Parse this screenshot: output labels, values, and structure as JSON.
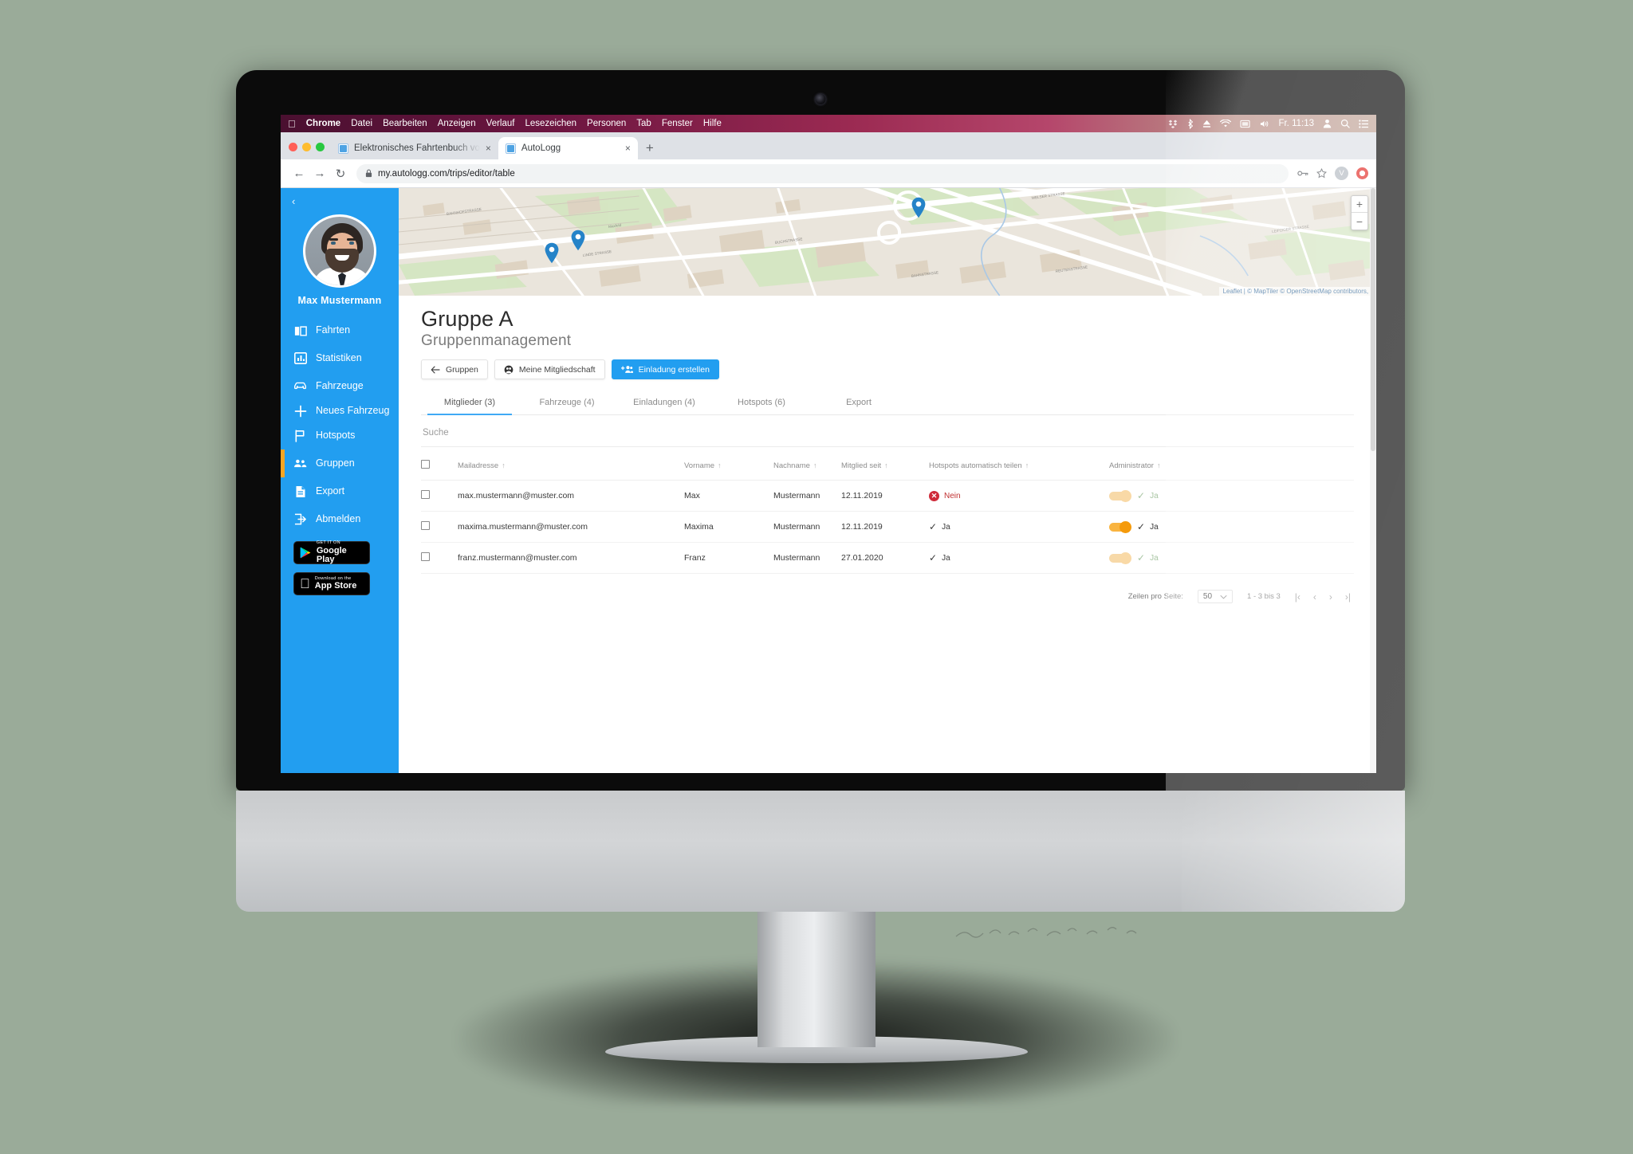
{
  "macos_menubar": {
    "apple_icon": "apple-icon",
    "items": [
      "Chrome",
      "Datei",
      "Bearbeiten",
      "Anzeigen",
      "Verlauf",
      "Lesezeichen",
      "Personen",
      "Tab",
      "Fenster",
      "Hilfe"
    ],
    "status": {
      "icons": [
        "dropbox-icon",
        "bluetooth-icon",
        "eject-icon",
        "wifi-icon",
        "screen-icon",
        "volume-icon"
      ],
      "clock": "Fr. 11:13",
      "trailing_icons": [
        "user-icon",
        "search-icon",
        "control-center-icon"
      ]
    }
  },
  "browser": {
    "tabs": [
      {
        "title": "Elektronisches Fahrtenbuch vo",
        "close": "×",
        "active": false
      },
      {
        "title": "AutoLogg",
        "close": "×",
        "active": true
      }
    ],
    "new_tab_label": "+",
    "nav": {
      "back": "←",
      "forward": "→",
      "reload": "↻"
    },
    "omnibox": {
      "lock_icon": "lock-icon",
      "url": "my.autologg.com/trips/editor/table"
    },
    "toolbar_right": {
      "key_icon": "key-icon",
      "star_icon": "star-icon",
      "profile_initial": "V",
      "extension_icon": "extension-icon"
    }
  },
  "sidebar": {
    "collapse_label": "‹",
    "user_name": "Max Mustermann",
    "items": [
      {
        "label": "Fahrten",
        "icon": "book-icon",
        "active": false
      },
      {
        "label": "Statistiken",
        "icon": "chart-icon",
        "active": false
      },
      {
        "label": "Fahrzeuge",
        "icon": "car-icon",
        "active": false
      },
      {
        "label": "Neues Fahrzeug",
        "icon": "plus-icon",
        "active": false
      },
      {
        "label": "Hotspots",
        "icon": "flag-icon",
        "active": false
      },
      {
        "label": "Gruppen",
        "icon": "people-icon",
        "active": true
      },
      {
        "label": "Export",
        "icon": "document-icon",
        "active": false
      },
      {
        "label": "Abmelden",
        "icon": "logout-icon",
        "active": false
      }
    ],
    "badges": [
      {
        "icon": "google-play-icon",
        "line1": "GET IT ON",
        "line2": "Google Play"
      },
      {
        "icon": "apple-icon",
        "line1": "Download on the",
        "line2": "App Store"
      }
    ]
  },
  "map": {
    "zoom_in": "+",
    "zoom_out": "−",
    "attribution": "Leaflet | © MapTiler © OpenStreetMap contributors, -",
    "pin_count": 3,
    "labels": [
      "Maxfeld",
      "WELSER STRASSE",
      "LEIPZIGER STRASSE",
      "LINDE STRASSE"
    ]
  },
  "page": {
    "title": "Gruppe A",
    "subtitle": "Gruppenmanagement",
    "buttons": [
      {
        "label": "Gruppen",
        "icon": "arrow-left-icon",
        "style": "default"
      },
      {
        "label": "Meine Mitgliedschaft",
        "icon": "membership-icon",
        "style": "default"
      },
      {
        "label": "Einladung erstellen",
        "icon": "add-person-icon",
        "style": "primary"
      }
    ],
    "tabs": [
      {
        "label": "Mitglieder (3)",
        "active": true
      },
      {
        "label": "Fahrzeuge (4)",
        "active": false
      },
      {
        "label": "Einladungen (4)",
        "active": false
      },
      {
        "label": "Hotspots (6)",
        "active": false
      },
      {
        "label": "Export",
        "active": false
      }
    ],
    "search": {
      "value": "",
      "placeholder": "Suche"
    }
  },
  "table": {
    "columns": [
      {
        "label": "",
        "key": "select"
      },
      {
        "label": "Mailadresse",
        "sort": "↑"
      },
      {
        "label": "Vorname",
        "sort": "↑"
      },
      {
        "label": "Nachname",
        "sort": "↑"
      },
      {
        "label": "Mitglied seit",
        "sort": "↑"
      },
      {
        "label": "Hotspots automatisch teilen",
        "sort": "↑"
      },
      {
        "label": "Administrator",
        "sort": "↑"
      }
    ],
    "rows": [
      {
        "email": "max.mustermann@muster.com",
        "first_name": "Max",
        "last_name": "Mustermann",
        "member_since": "12.11.2019",
        "hotspots_share": {
          "value": "Nein",
          "state": "no"
        },
        "admin": {
          "toggle": "off",
          "value": "Ja",
          "dim": true
        }
      },
      {
        "email": "maxima.mustermann@muster.com",
        "first_name": "Maxima",
        "last_name": "Mustermann",
        "member_since": "12.11.2019",
        "hotspots_share": {
          "value": "Ja",
          "state": "yes"
        },
        "admin": {
          "toggle": "on",
          "value": "Ja",
          "dim": false
        }
      },
      {
        "email": "franz.mustermann@muster.com",
        "first_name": "Franz",
        "last_name": "Mustermann",
        "member_since": "27.01.2020",
        "hotspots_share": {
          "value": "Ja",
          "state": "yes"
        },
        "admin": {
          "toggle": "off",
          "value": "Ja",
          "dim": true
        }
      }
    ]
  },
  "pagination": {
    "rows_per_page_label": "Zeilen pro Seite:",
    "rows_per_page_value": "50",
    "range": "1 - 3 bis 3",
    "first": "|‹",
    "prev": "‹",
    "next": "›",
    "last": "›|"
  },
  "colors": {
    "brand_blue": "#229ef0",
    "accent_orange": "#f5a623",
    "danger_red": "#cf2b3a",
    "tab_underline": "#3fa9f5"
  }
}
